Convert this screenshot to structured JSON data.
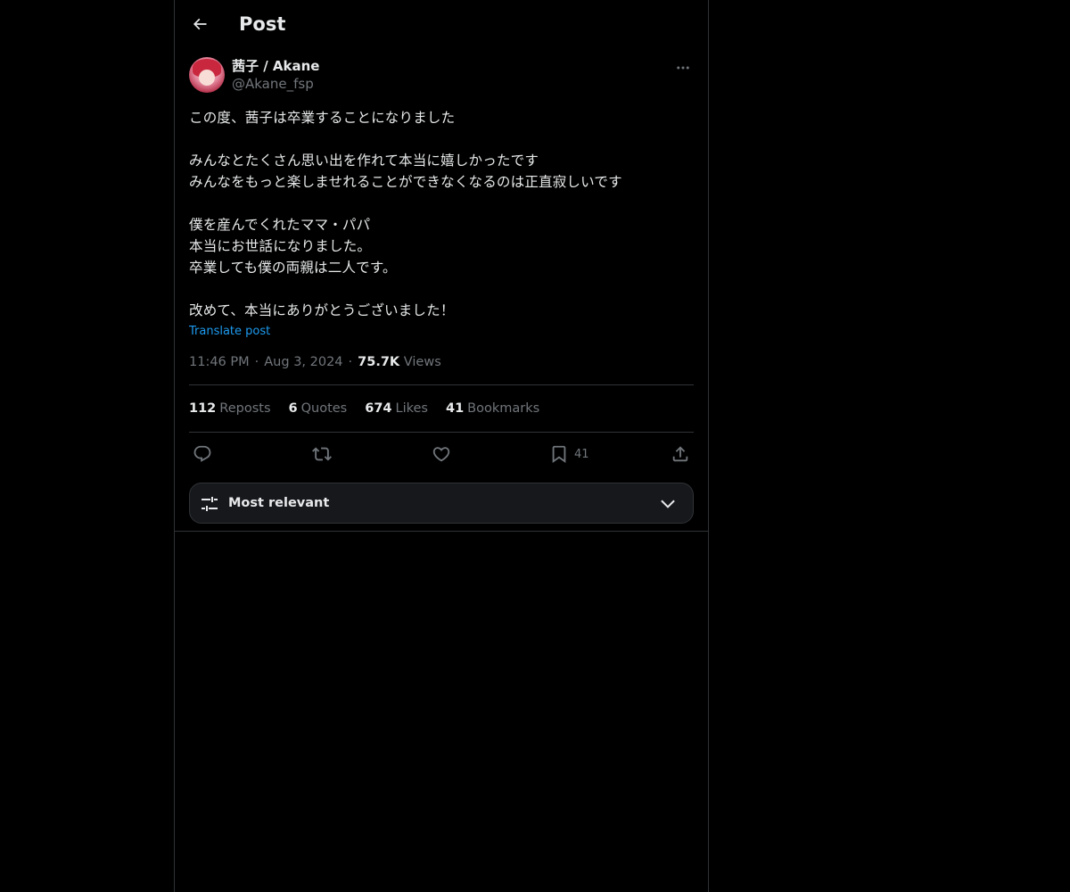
{
  "header": {
    "title": "Post",
    "back_icon": "arrow-left-icon"
  },
  "author": {
    "display_name": "茜子 / Akane",
    "handle": "@Akane_fsp"
  },
  "post": {
    "text": "この度、茜子は卒業することになりました\n\nみんなとたくさん思い出を作れて本当に嬉しかったです\nみんなをもっと楽しませれることができなくなるのは正直寂しいです\n\n僕を産んでくれたママ・パパ\n本当にお世話になりました。\n卒業しても僕の両親は二人です。\n\n改めて、本当にありがとうございました！",
    "translate_label": "Translate post",
    "time": "11:46 PM",
    "separator": "·",
    "date": "Aug 3, 2024",
    "views_count": "75.7K",
    "views_label": "Views"
  },
  "stats": [
    {
      "count": "112",
      "label": "Reposts"
    },
    {
      "count": "6",
      "label": "Quotes"
    },
    {
      "count": "674",
      "label": "Likes"
    },
    {
      "count": "41",
      "label": "Bookmarks"
    }
  ],
  "actions": {
    "reply_icon": "reply-icon",
    "repost_icon": "repost-icon",
    "like_icon": "heart-icon",
    "bookmark_icon": "bookmark-icon",
    "bookmark_count": "41",
    "share_icon": "share-icon"
  },
  "sort": {
    "label": "Most relevant",
    "icon": "sliders-icon",
    "chevron": "chevron-down-icon"
  },
  "colors": {
    "background": "#000000",
    "text": "#e7e9ea",
    "muted": "#71767b",
    "link": "#1d9bf0",
    "border": "#2f3336"
  }
}
